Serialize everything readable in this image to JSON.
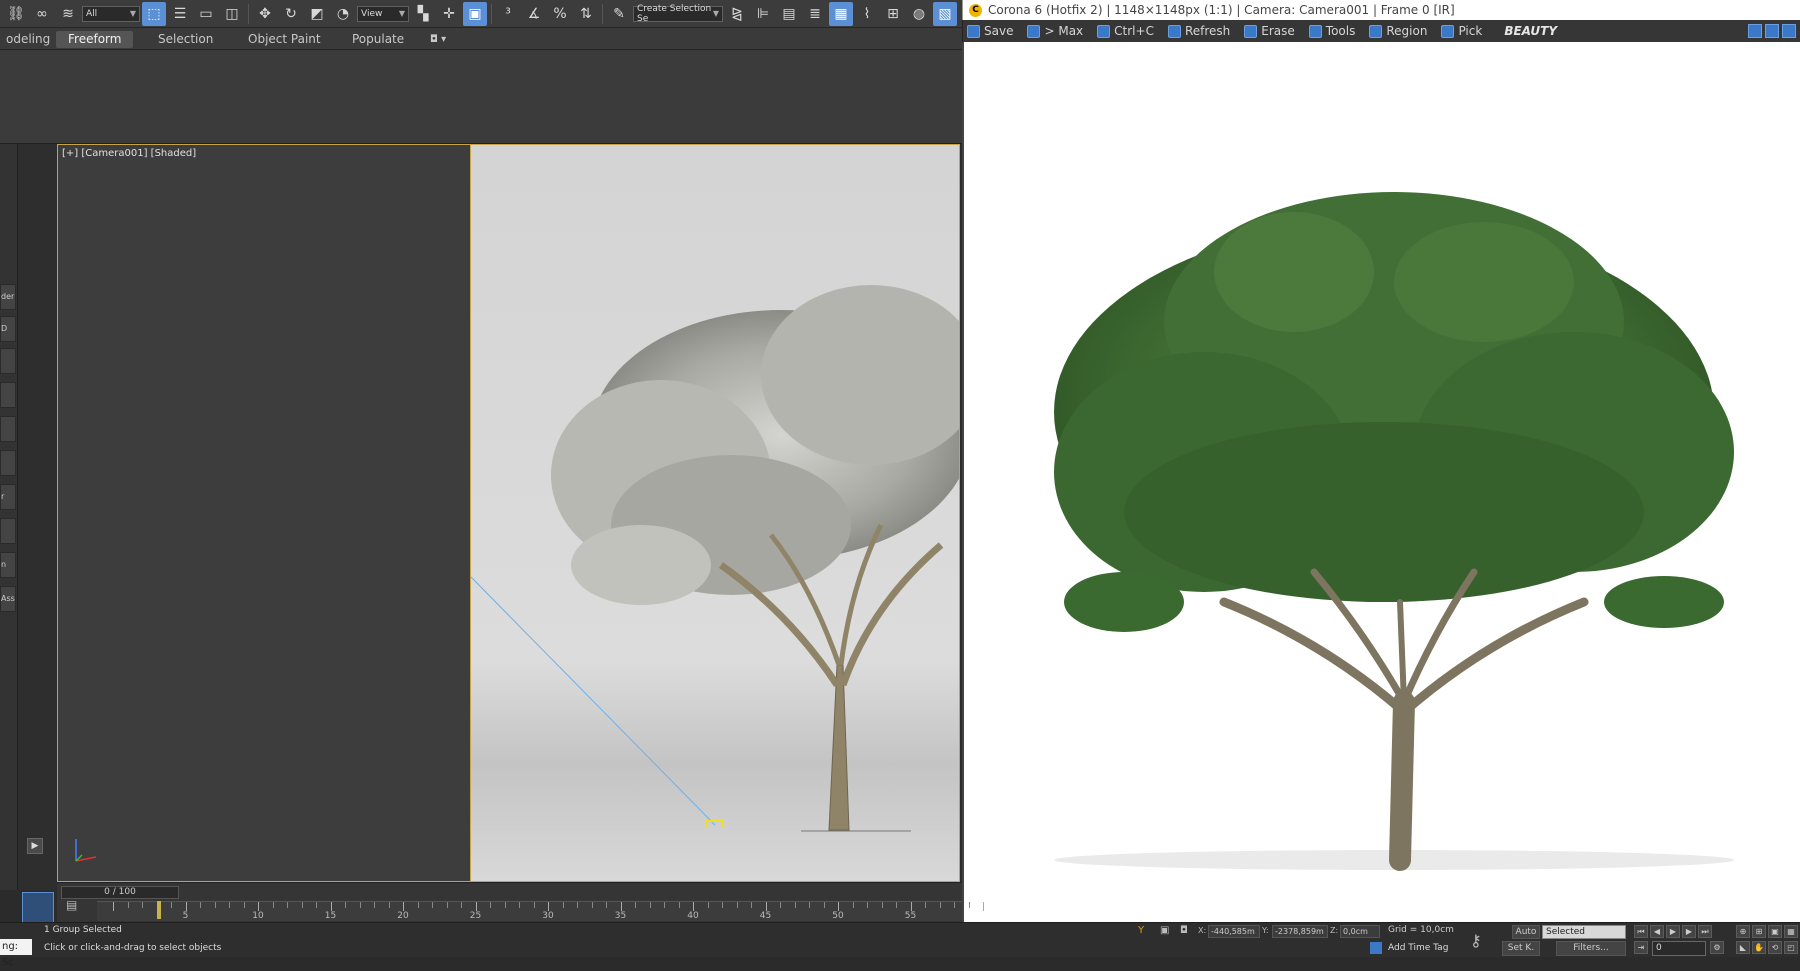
{
  "toolbar": {
    "selection_filter": "All",
    "ref_coord_system": "View",
    "named_selection_set": "Create Selection Se"
  },
  "ribbon": {
    "tabs": [
      "odeling",
      "Freeform",
      "Selection",
      "Object Paint",
      "Populate"
    ],
    "active_tab": "Freeform"
  },
  "left_strip": {
    "labels": [
      "der",
      "D",
      "",
      "",
      "",
      "",
      "r",
      "",
      "n",
      "Assi"
    ]
  },
  "viewport": {
    "label": "[+] [Camera001] [Shaded]"
  },
  "frame_window": {
    "title": "Corona 6 (Hotfix 2) | 1148×1148px (1:1) | Camera: Camera001 | Frame 0 [IR]",
    "toolbar": {
      "save": "Save",
      "max": "> Max",
      "copy": "Ctrl+C",
      "refresh": "Refresh",
      "erase": "Erase",
      "tools": "Tools",
      "region": "Region",
      "pick": "Pick",
      "render_element": "BEAUTY"
    }
  },
  "timeline": {
    "slider_label": "0 / 100",
    "current_frame": 0,
    "ticks": [
      "5",
      "10",
      "15",
      "20",
      "25",
      "30",
      "35",
      "40",
      "45",
      "50",
      "55"
    ]
  },
  "status_bar": {
    "selection_info": "1 Group Selected",
    "prompt": "Click or click-and-drag to select objects",
    "left_input": "ng: Sc",
    "x_label": "X:",
    "x_value": "-440,585m",
    "y_label": "Y:",
    "y_value": "-2378,859m",
    "z_label": "Z:",
    "z_value": "0,0cm",
    "grid": "Grid = 10,0cm",
    "add_time_tag": "Add Time Tag",
    "auto_key": "Auto",
    "set_key": "Set K.",
    "key_filter": "Selected",
    "filters": "Filters...",
    "frame_field": "0"
  },
  "colors": {
    "accent_blue": "#5b8fd6",
    "viewport_border": "#c7a34a",
    "foliage_green": "#3e6b32"
  }
}
